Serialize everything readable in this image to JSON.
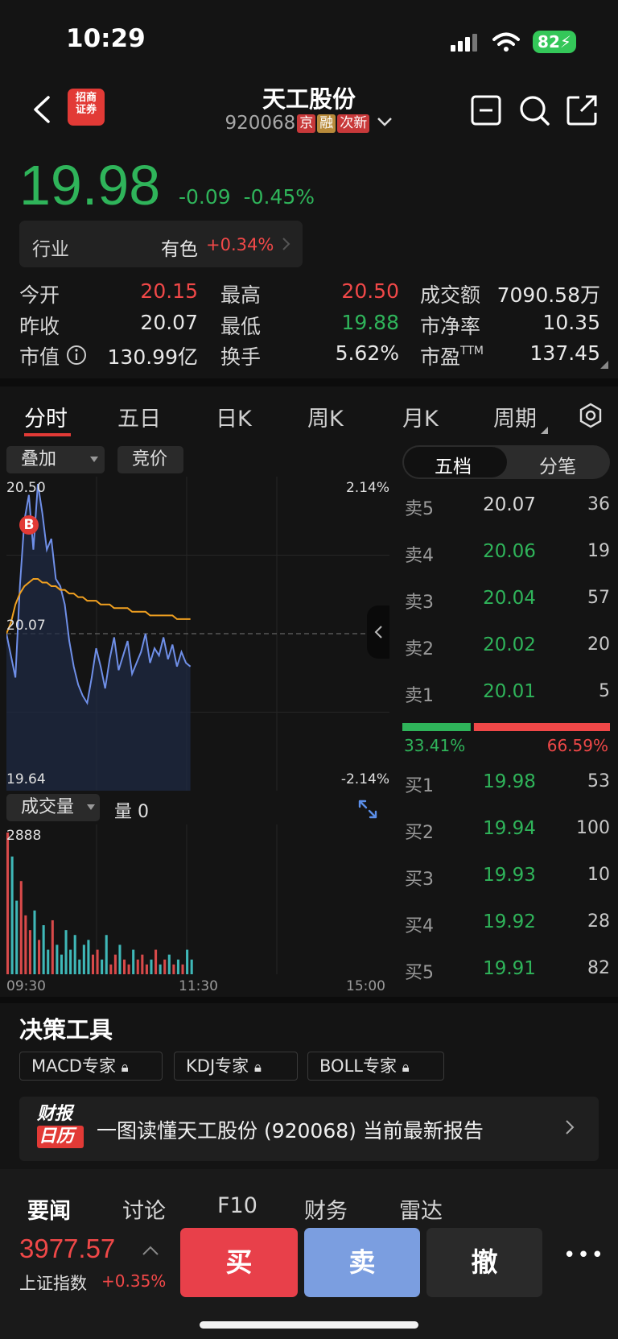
{
  "status": {
    "time": "10:29",
    "battery": "82"
  },
  "header": {
    "broker_logo": "招商证券",
    "title": "天工股份",
    "code": "920068",
    "tags": [
      "京",
      "融",
      "次新"
    ]
  },
  "quote": {
    "price": "19.98",
    "change": "-0.09",
    "change_pct": "-0.45%",
    "industry_label": "行业",
    "industry_name": "有色",
    "industry_pct": "+0.34%"
  },
  "stats": {
    "open_label": "今开",
    "open": "20.15",
    "high_label": "最高",
    "high": "20.50",
    "amount_label": "成交额",
    "amount": "7090.58万",
    "prev_label": "昨收",
    "prev": "20.07",
    "low_label": "最低",
    "low": "19.88",
    "pb_label": "市净率",
    "pb": "10.35",
    "mcap_label": "市值",
    "mcap": "130.99亿",
    "turnover_label": "换手",
    "turnover": "5.62%",
    "pe_label": "市盈",
    "pe_sup": "TTM",
    "pe": "137.45"
  },
  "chart_tabs": [
    "分时",
    "五日",
    "日K",
    "周K",
    "月K",
    "周期"
  ],
  "chart_controls": {
    "overlay": "叠加",
    "auction": "竞价",
    "volume": "成交量",
    "volume_value": "量 0"
  },
  "chart_data": {
    "type": "line",
    "y_labels": {
      "top": "20.50",
      "mid": "20.07",
      "bottom": "19.64"
    },
    "pct_labels": {
      "top": "2.14%",
      "bottom": "-2.14%"
    },
    "volume_top": "2888",
    "x_labels": [
      "09:30",
      "11:30",
      "15:00"
    ],
    "buy_marker": "B",
    "ylim": [
      19.64,
      20.5
    ],
    "prev_close": 20.07,
    "price_series": [
      20.07,
      20.01,
      19.95,
      20.2,
      20.38,
      20.45,
      20.3,
      20.48,
      20.4,
      20.3,
      20.33,
      20.22,
      20.2,
      20.15,
      20.05,
      19.98,
      19.93,
      19.9,
      19.88,
      19.95,
      20.03,
      19.98,
      19.92,
      20.0,
      20.06,
      19.97,
      20.01,
      20.05,
      19.96,
      19.99,
      20.02,
      20.07,
      19.99,
      20.03,
      20.01,
      20.06,
      20.0,
      20.04,
      19.98,
      20.02,
      19.99,
      19.98
    ],
    "avg_series": [
      20.07,
      20.1,
      20.15,
      20.18,
      20.2,
      20.21,
      20.22,
      20.22,
      20.21,
      20.21,
      20.2,
      20.2,
      20.19,
      20.19,
      20.18,
      20.18,
      20.17,
      20.17,
      20.16,
      20.16,
      20.16,
      20.15,
      20.15,
      20.15,
      20.14,
      20.14,
      20.14,
      20.14,
      20.13,
      20.13,
      20.13,
      20.13,
      20.12,
      20.12,
      20.12,
      20.12,
      20.12,
      20.12,
      20.11,
      20.11,
      20.11,
      20.11
    ],
    "volume_series": [
      2888,
      2400,
      1500,
      1900,
      1200,
      900,
      1300,
      700,
      1000,
      500,
      1100,
      600,
      400,
      900,
      500,
      800,
      300,
      600,
      700,
      400,
      500,
      300,
      800,
      200,
      400,
      600,
      300,
      200,
      500,
      300,
      400,
      200,
      300,
      500,
      200,
      300,
      400,
      200,
      300,
      200,
      500,
      300
    ],
    "volume_max": 2888
  },
  "orderbook": {
    "tabs": [
      "五档",
      "分笔"
    ],
    "asks": [
      {
        "label": "卖5",
        "price": "20.07",
        "vol": "36",
        "color": "white"
      },
      {
        "label": "卖4",
        "price": "20.06",
        "vol": "19",
        "color": "green"
      },
      {
        "label": "卖3",
        "price": "20.04",
        "vol": "57",
        "color": "green"
      },
      {
        "label": "卖2",
        "price": "20.02",
        "vol": "20",
        "color": "green"
      },
      {
        "label": "卖1",
        "price": "20.01",
        "vol": "5",
        "color": "green"
      }
    ],
    "buy_ratio": "33.41%",
    "sell_ratio": "66.59%",
    "buy_ratio_value": 0.3341,
    "bids": [
      {
        "label": "买1",
        "price": "19.98",
        "vol": "53",
        "color": "green"
      },
      {
        "label": "买2",
        "price": "19.94",
        "vol": "100",
        "color": "green"
      },
      {
        "label": "买3",
        "price": "19.93",
        "vol": "10",
        "color": "green"
      },
      {
        "label": "买4",
        "price": "19.92",
        "vol": "28",
        "color": "green"
      },
      {
        "label": "买5",
        "price": "19.91",
        "vol": "82",
        "color": "green"
      }
    ]
  },
  "tools": {
    "title": "决策工具",
    "items": [
      "MACD专家",
      "KDJ专家",
      "BOLL专家"
    ]
  },
  "report": {
    "logo_top": "财报",
    "logo_bottom": "日历",
    "text": "一图读懂天工股份 (920068) 当前最新报告"
  },
  "bottom_tabs": [
    "要闻",
    "讨论",
    "F10",
    "财务",
    "雷达"
  ],
  "index": {
    "value": "3977.57",
    "name": "上证指数",
    "pct": "+0.35%"
  },
  "trade": {
    "buy": "买",
    "sell": "卖",
    "cancel": "撤",
    "more": "•••"
  },
  "colors": {
    "up": "#f04848",
    "down": "#2fb45a",
    "buy_btn": "#e8404a",
    "sell_btn": "#7b9ee0",
    "avg_line": "#f0a020",
    "price_line": "#6f8fe8"
  }
}
